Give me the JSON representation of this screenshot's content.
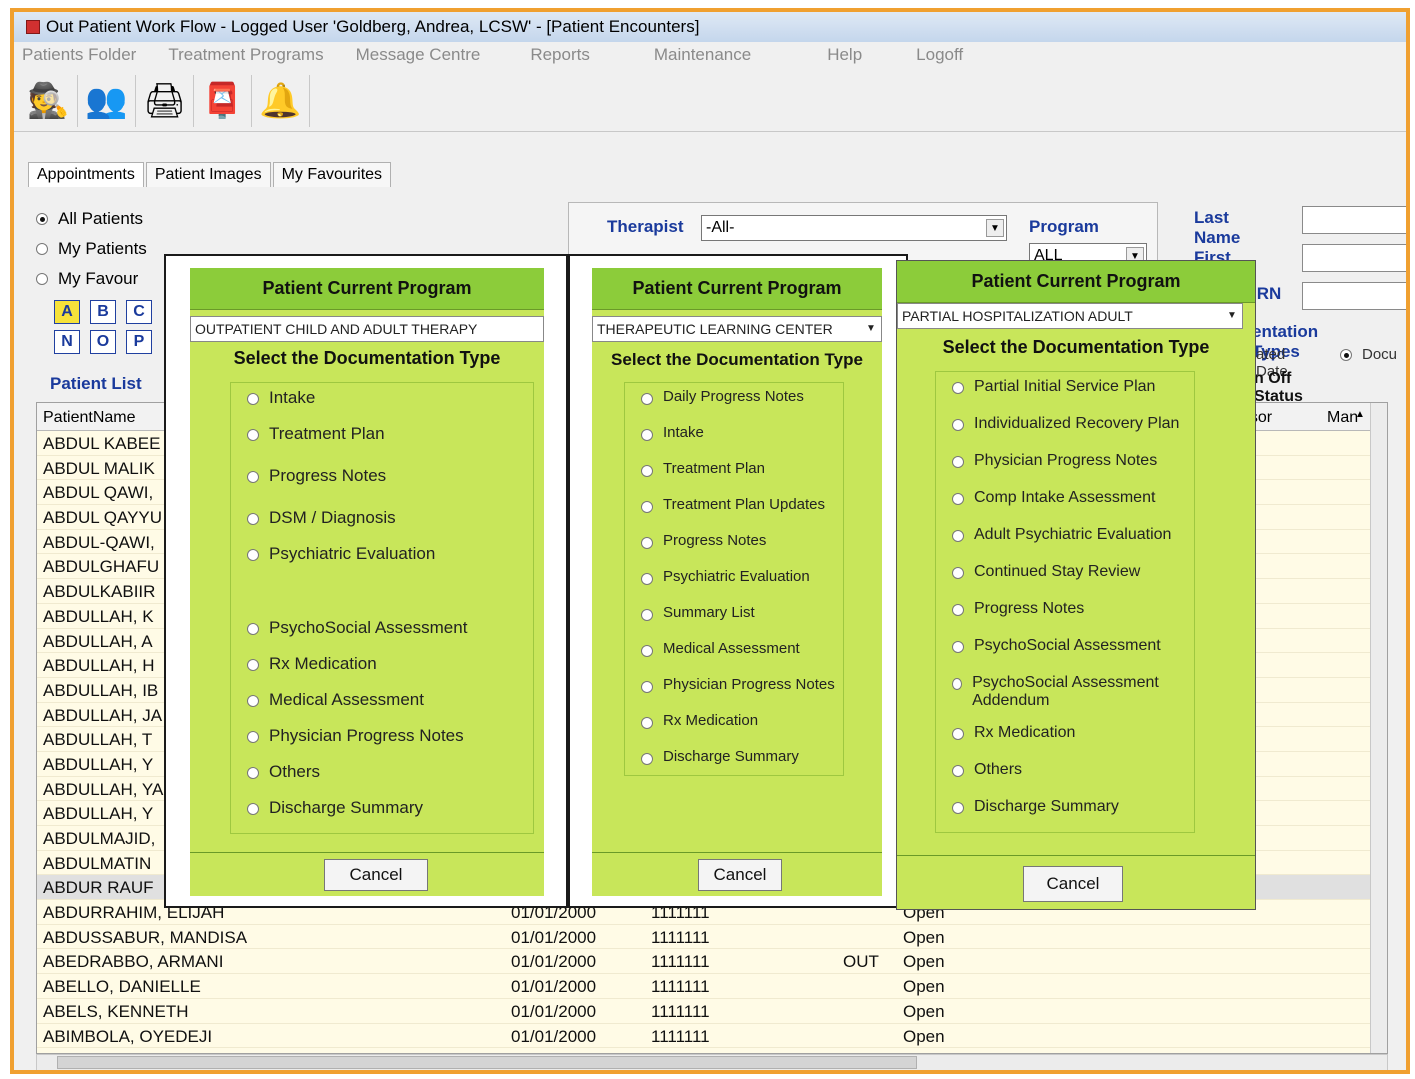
{
  "window": {
    "title": "Out Patient Work Flow  -  Logged User 'Goldberg, Andrea, LCSW' - [Patient Encounters]"
  },
  "menu": [
    "Patients Folder",
    "Treatment Programs",
    "Message Centre",
    "Reports",
    "Maintenance",
    "Help",
    "Logoff"
  ],
  "tabs": [
    "Appointments",
    "Patient Images",
    "My Favourites"
  ],
  "filters": {
    "all_patients": "All Patients",
    "my_patients": "My Patients",
    "my_favourites": "My Favour",
    "letters": [
      "A",
      "B",
      "C",
      "N",
      "O",
      "P"
    ],
    "patient_list_label": "Patient List",
    "therapist_label": "Therapist",
    "therapist_value": "-All-",
    "program_label": "Program",
    "program_value": "ALL",
    "last_name_label": "Last Name",
    "first_name_label": "First Name",
    "mrn_label": "IRN",
    "doc_types_label": "entation Types",
    "date_option": "ated Date",
    "doc_option": "Docu",
    "status_label": "n Off Status"
  },
  "grid": {
    "headers": {
      "name": "PatientName",
      "supervisor": "rvisor",
      "man": "Man"
    },
    "names_partial": [
      "ABDUL KABEE",
      "ABDUL MALIK",
      "ABDUL QAWI,",
      "ABDUL QAYYU",
      "ABDUL-QAWI,",
      "ABDULGHAFU",
      "ABDULKABIIR",
      "ABDULLAH, K",
      "ABDULLAH, A",
      "ABDULLAH, H",
      "ABDULLAH, IB",
      "ABDULLAH, JA",
      "ABDULLAH, T",
      "ABDULLAH, Y",
      "ABDULLAH, YA",
      "ABDULLAH, Y",
      "ABDULMAJID,",
      "ABDULMATIN",
      "ABDUR RAUF"
    ],
    "rows": [
      {
        "name": "ABDURRAHIM, ELIJAH",
        "dob": "01/01/2000",
        "mrn": "1111111",
        "flag": "",
        "status": "Open"
      },
      {
        "name": "ABDUSSABUR, MANDISA",
        "dob": "01/01/2000",
        "mrn": "1111111",
        "flag": "",
        "status": "Open"
      },
      {
        "name": "ABEDRABBO, ARMANI",
        "dob": "01/01/2000",
        "mrn": "1111111",
        "flag": "OUT",
        "status": "Open"
      },
      {
        "name": "ABELLO, DANIELLE",
        "dob": "01/01/2000",
        "mrn": "1111111",
        "flag": "",
        "status": "Open"
      },
      {
        "name": "ABELS, KENNETH",
        "dob": "01/01/2000",
        "mrn": "1111111",
        "flag": "",
        "status": "Open"
      },
      {
        "name": "ABIMBOLA, OYEDEJI",
        "dob": "01/01/2000",
        "mrn": "1111111",
        "flag": "",
        "status": "Open"
      }
    ]
  },
  "dialogs": [
    {
      "title": "Patient Current Program",
      "program": "OUTPATIENT CHILD AND ADULT THERAPY",
      "subtitle": "Select the Documentation Type",
      "options": [
        "Intake",
        "Treatment Plan",
        "Progress Notes",
        "DSM / Diagnosis",
        "Psychiatric Evaluation",
        "PsychoSocial Assessment",
        "Rx Medication",
        "Medical Assessment",
        "Physician Progress Notes",
        "Others",
        "Discharge Summary"
      ],
      "cancel": "Cancel"
    },
    {
      "title": "Patient Current Program",
      "program": "THERAPEUTIC LEARNING CENTER",
      "subtitle": "Select the Documentation Type",
      "options": [
        "Daily Progress Notes",
        "Intake",
        "Treatment Plan",
        "Treatment Plan Updates",
        "Progress Notes",
        "Psychiatric Evaluation",
        "Summary List",
        "Medical Assessment",
        "Physician Progress Notes",
        "Rx Medication",
        "Discharge Summary"
      ],
      "cancel": "Cancel"
    },
    {
      "title": "Patient Current Program",
      "program": "PARTIAL HOSPITALIZATION ADULT",
      "subtitle": "Select the Documentation Type",
      "options": [
        "Partial Initial Service Plan",
        "Individualized Recovery Plan",
        "Physician Progress Notes",
        "Comp Intake Assessment",
        "Adult Psychiatric Evaluation",
        "Continued Stay Review",
        "Progress Notes",
        "PsychoSocial Assessment",
        "PsychoSocial Assessment Addendum",
        "Rx Medication",
        "Others",
        "Discharge Summary"
      ],
      "cancel": "Cancel"
    }
  ],
  "icons": [
    "help-desk-icon",
    "users-icon",
    "scanner-icon",
    "mail-icon",
    "bell-icon"
  ]
}
